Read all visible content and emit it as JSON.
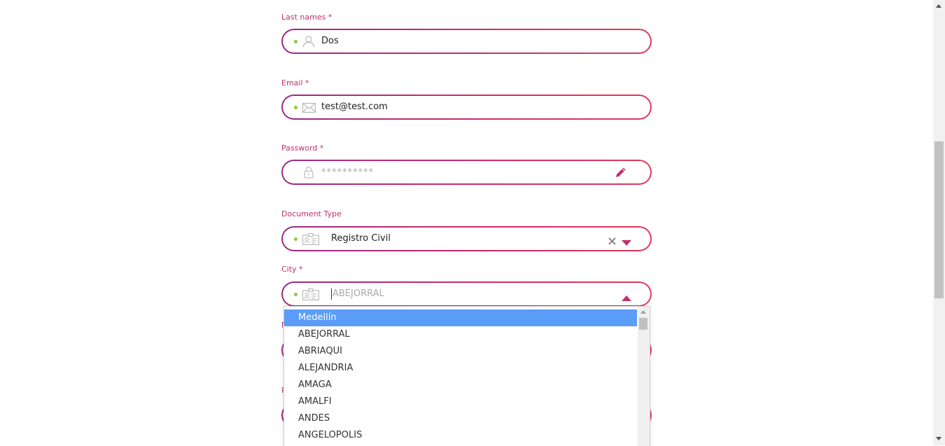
{
  "form": {
    "last_names": {
      "label": "Last names *",
      "value": "Dos"
    },
    "email": {
      "label": "Email *",
      "value": "test@test.com"
    },
    "password": {
      "label": "Password *",
      "value": "**********"
    },
    "document_type": {
      "label": "Document Type",
      "value": "Registro Civil"
    },
    "city": {
      "label": "City *",
      "placeholder": "ABEJORRAL",
      "options": [
        "Medellín",
        "ABEJORRAL",
        "ABRIAQUI",
        "ALEJANDRIA",
        "AMAGA",
        "AMALFI",
        "ANDES",
        "ANGELOPOLIS"
      ],
      "highlighted": "Medellín"
    },
    "obscured_labels": [
      "N",
      "P"
    ]
  },
  "colors": {
    "label": "#c0306a",
    "border_start": "#9b2a84",
    "border_end": "#e23a5a",
    "valid_dot": "#8cc63f",
    "highlight": "#5a9cf8"
  },
  "icons": [
    "user-icon",
    "envelope-icon",
    "lock-icon",
    "pencil-icon",
    "id-card-icon",
    "clear-x-icon",
    "caret-down-icon",
    "caret-up-icon"
  ]
}
